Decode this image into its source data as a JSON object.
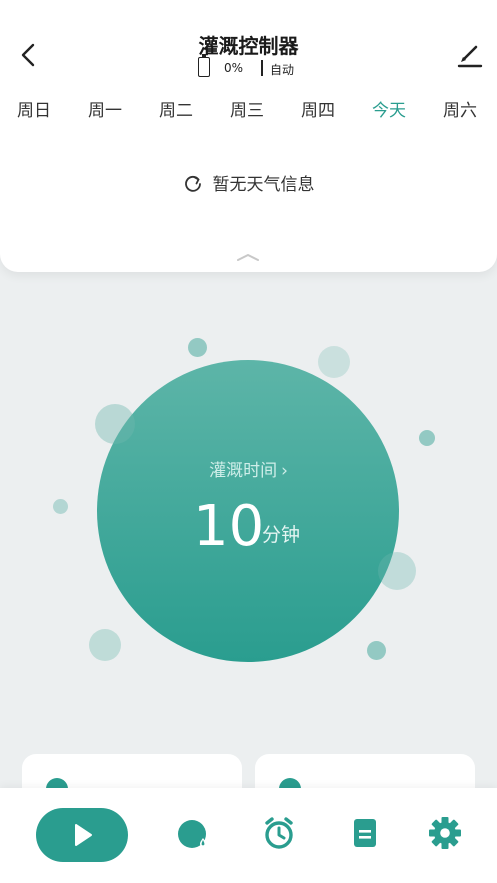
{
  "header": {
    "title": "灌溉控制器",
    "battery_text": "0%",
    "mode_text": "自动"
  },
  "week_tabs": [
    {
      "label": "周日",
      "active": false
    },
    {
      "label": "周一",
      "active": false
    },
    {
      "label": "周二",
      "active": false
    },
    {
      "label": "周三",
      "active": false
    },
    {
      "label": "周四",
      "active": false
    },
    {
      "label": "今天",
      "active": true
    },
    {
      "label": "周六",
      "active": false
    }
  ],
  "weather": {
    "text": "暂无天气信息"
  },
  "irrigation": {
    "label": "灌溉时间",
    "arrow": "›",
    "value": "10",
    "unit": "分钟"
  },
  "colors": {
    "accent": "#2a9d8f",
    "background": "#eceff0"
  },
  "bottom_nav": [
    {
      "name": "play-icon"
    },
    {
      "name": "water-stats-icon"
    },
    {
      "name": "alarm-clock-icon"
    },
    {
      "name": "log-icon"
    },
    {
      "name": "settings-gear-icon"
    }
  ]
}
